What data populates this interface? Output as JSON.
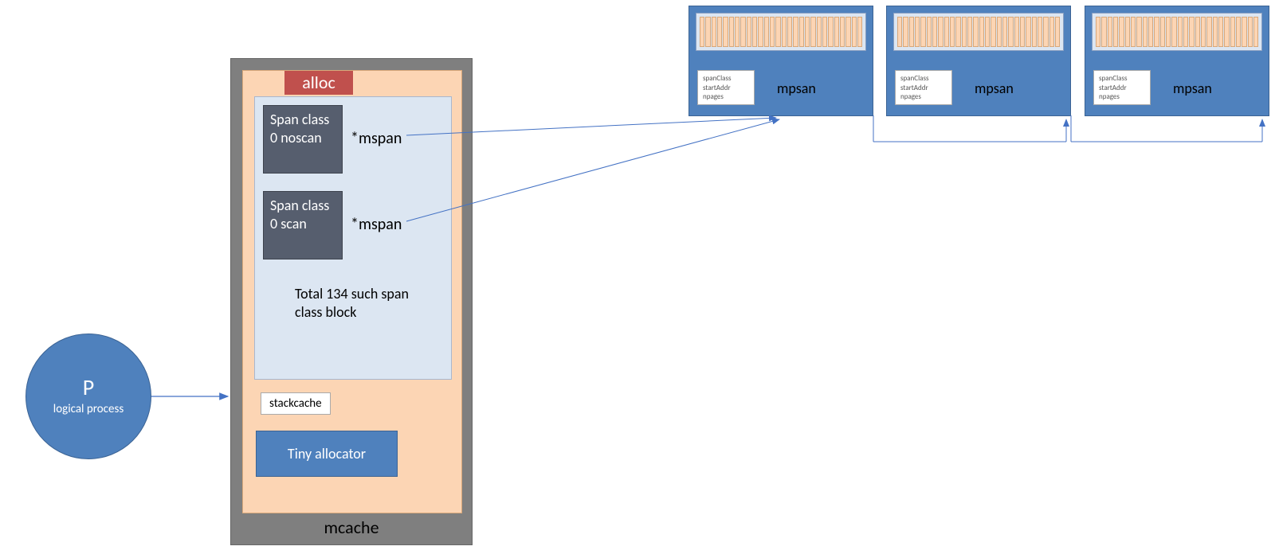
{
  "process": {
    "letter": "P",
    "subtitle": "logical process"
  },
  "mcache": {
    "label": "mcache",
    "alloc_label": "alloc",
    "span0_noscan": "Span class 0 noscan",
    "span0_scan": "Span class 0 scan",
    "mspan_ptr": "*mspan",
    "total_note": "Total 134 such span class block",
    "stackcache": "stackcache",
    "tiny": "Tiny allocator"
  },
  "mpsan": {
    "label": "mpsan",
    "attr1": "spanClass",
    "attr2": "startAddr",
    "attr3": "npages"
  }
}
